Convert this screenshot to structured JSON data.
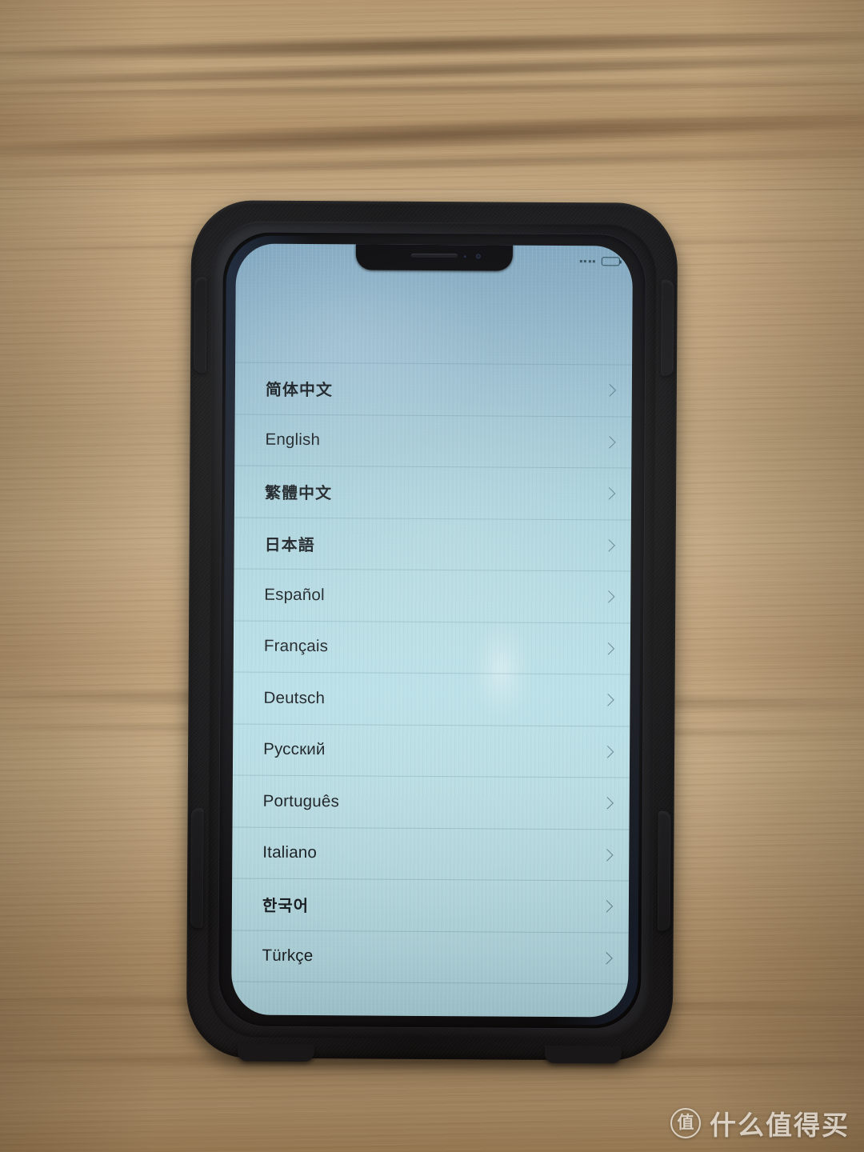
{
  "device": {
    "kind": "smartphone-in-rugged-case",
    "case_color": "#141417",
    "case_accent_color": "#c0392b",
    "screen_bg_top": "#7ea6c0",
    "screen_bg_bottom": "#b4dce6"
  },
  "status_bar": {
    "signal_dots": 4,
    "battery_icon": "battery-icon",
    "battery_level_percent": 90
  },
  "screen": {
    "title": "",
    "list_name": "language-selection-list",
    "chevron_icon": "chevron-right-icon",
    "languages": [
      {
        "label": "简体中文",
        "script": "cjk"
      },
      {
        "label": "English",
        "script": "latin"
      },
      {
        "label": "繁體中文",
        "script": "cjk"
      },
      {
        "label": "日本語",
        "script": "cjk"
      },
      {
        "label": "Español",
        "script": "latin"
      },
      {
        "label": "Français",
        "script": "latin"
      },
      {
        "label": "Deutsch",
        "script": "latin"
      },
      {
        "label": "Русский",
        "script": "cyrillic"
      },
      {
        "label": "Português",
        "script": "latin"
      },
      {
        "label": "Italiano",
        "script": "latin"
      },
      {
        "label": "한국어",
        "script": "cjk"
      },
      {
        "label": "Türkçe",
        "script": "latin"
      }
    ]
  },
  "watermark": {
    "badge_char": "值",
    "text": "什么值得买",
    "color": "#f6f3ee"
  },
  "background": {
    "surface": "wood-table",
    "base_color": "#b89a73",
    "grain_color": "#4a2f17"
  }
}
